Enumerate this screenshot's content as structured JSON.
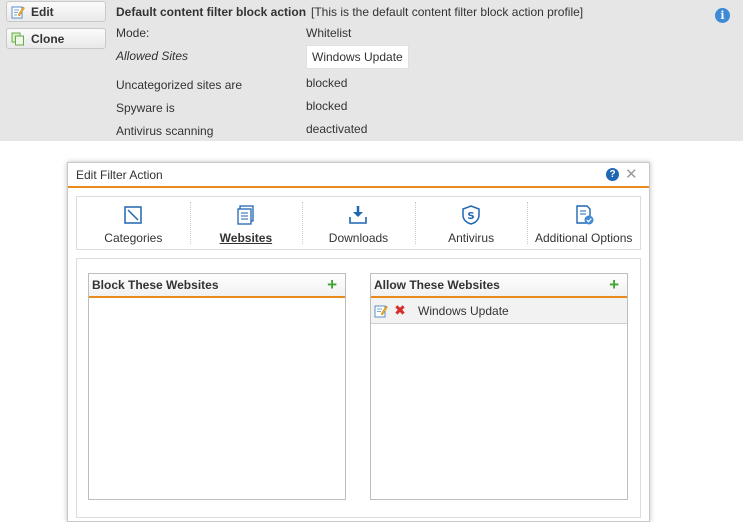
{
  "summary": {
    "buttons": {
      "edit_label": "Edit",
      "clone_label": "Clone"
    },
    "title": "Default content filter block action",
    "description": "[This is the default content filter block action profile]",
    "rows": [
      {
        "label": "Mode:",
        "value": "Whitelist"
      },
      {
        "label": "Allowed Sites",
        "value": "Windows Update"
      },
      {
        "label": "Uncategorized sites are",
        "value": "blocked"
      },
      {
        "label": "Spyware is",
        "value": "blocked"
      },
      {
        "label": "Antivirus scanning",
        "value": "deactivated"
      }
    ],
    "info_icon": "info-icon"
  },
  "dialog": {
    "title": "Edit Filter Action",
    "tabs": [
      {
        "label": "Categories",
        "icon": "categories-icon",
        "active": false
      },
      {
        "label": "Websites",
        "icon": "websites-icon",
        "active": true
      },
      {
        "label": "Downloads",
        "icon": "downloads-icon",
        "active": false
      },
      {
        "label": "Antivirus",
        "icon": "antivirus-icon",
        "active": false
      },
      {
        "label": "Additional Options",
        "icon": "additional-options-icon",
        "active": false
      }
    ],
    "block_panel": {
      "title": "Block These Websites",
      "items": []
    },
    "allow_panel": {
      "title": "Allow These Websites",
      "items": [
        {
          "label": "Windows Update"
        }
      ]
    }
  },
  "colors": {
    "accent_orange": "#e98a1c",
    "add_green": "#3fa535",
    "delete_red": "#d62b2b",
    "info_blue": "#3e8ad6",
    "summary_bg": "#e6e6e6"
  }
}
